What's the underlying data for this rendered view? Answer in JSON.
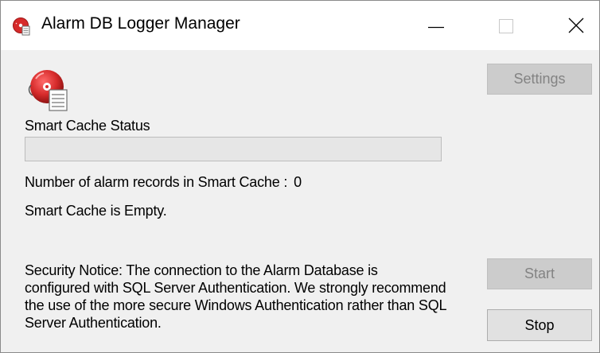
{
  "window": {
    "title": "Alarm DB Logger Manager",
    "controls": {
      "minimize": "minimize-icon",
      "maximize": "maximize-icon",
      "close": "close-icon"
    }
  },
  "app_icon": "alarm-db-logger-icon",
  "smart_cache": {
    "status_label": "Smart Cache Status",
    "progress_percent": 0,
    "count_label": "Number of alarm records in Smart Cache :",
    "count_value": "0",
    "state_text": "Smart Cache is Empty."
  },
  "security_notice": "Security Notice: The connection to the Alarm Database is configured with SQL Server Authentication. We strongly recommend the use of the more secure Windows Authentication rather than SQL Server Authentication.",
  "buttons": {
    "settings": "Settings",
    "start": "Start",
    "stop": "Stop"
  },
  "colors": {
    "accent_red": "#d62b2b",
    "window_bg": "#f0f0f0",
    "progress_fill": "#06b025"
  }
}
